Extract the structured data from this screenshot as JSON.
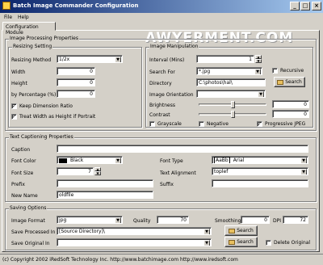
{
  "window": {
    "title": "Batch Image Commander Configuration"
  },
  "menu": [
    "File",
    "Help"
  ],
  "tab": "Configuration Module",
  "watermark": "AWYERMENT.COM",
  "image_group": {
    "title": "Image Processing Properties"
  },
  "resize": {
    "title": "Resizing Setting",
    "method_label": "Resizing Method",
    "method_value": "1/2x",
    "width_label": "Width",
    "width_value": "0",
    "height_label": "Height",
    "height_value": "0",
    "percent_label": "by Percentage (%)",
    "percent_value": "0",
    "keep_ratio": "Keep Dimension Ratio",
    "treat_width": "Treat Width as Height if Portrait"
  },
  "manip": {
    "title": "Image Manipulation",
    "interval_label": "Interval (Mins)",
    "interval_value": "1",
    "search_label": "Search For",
    "search_value": "*.jpg",
    "recursive": "Recursive",
    "directory_label": "Directory",
    "directory_value": "C:\\photos\\hal\\",
    "search_btn": "Search",
    "orientation_label": "Image Orientation",
    "brightness_label": "Brightness",
    "brightness_value": "0",
    "contrast_label": "Contrast",
    "contrast_value": "0",
    "grayscale": "Grayscale",
    "negative": "Negative",
    "progressive": "Progressive JPEG"
  },
  "caption": {
    "title": "Text Captioning Properties",
    "caption_label": "Caption",
    "color_label": "Font Color",
    "color_value": "Black",
    "size_label": "Font Size",
    "size_value": "7",
    "prefix_label": "Prefix",
    "newname_label": "New Name",
    "newname_value": "oldfile",
    "type_label": "Font Type",
    "type_value": "Arial",
    "type_sample": "AaBb",
    "align_label": "Text Alignment",
    "align_value": "toplef",
    "suffix_label": "Suffix"
  },
  "saving": {
    "title": "Saving Options",
    "format_label": "Image Format",
    "format_value": "jpg",
    "quality_label": "Quality",
    "quality_value": "70",
    "smoothing_label": "Smoothing",
    "smoothing_value": "0",
    "dpi_label": "DPI",
    "dpi_value": "72",
    "save_label": "Save Processed In",
    "save_value": "[Source Directory]\\",
    "original_label": "Save Original In",
    "search_btn": "Search",
    "delete_original": "Delete Original"
  },
  "status": "(c) Copyright 2002 iRedSoft Technology Inc. http://www.batchimage.com http://www.iredsoft.com"
}
